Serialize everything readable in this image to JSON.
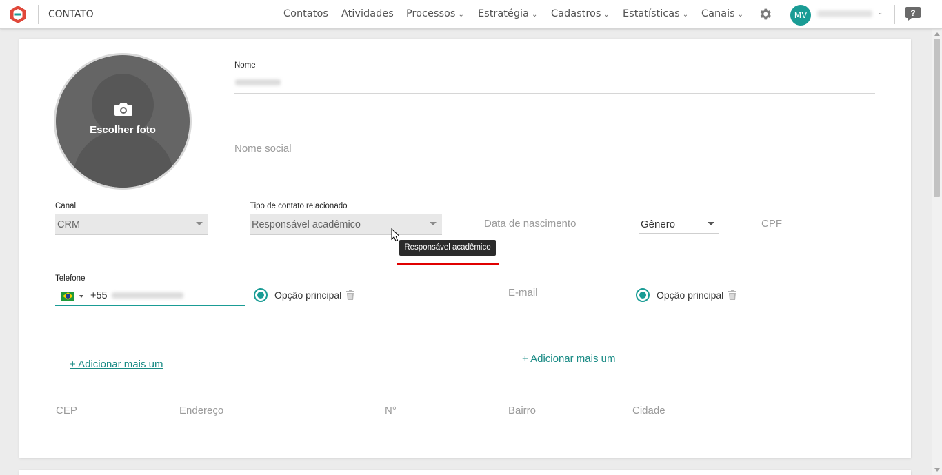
{
  "header": {
    "app_title": "CONTATO",
    "nav": [
      {
        "label": "Contatos",
        "chev": ""
      },
      {
        "label": "Atividades",
        "chev": ""
      },
      {
        "label": "Processos",
        "chev": "⌄"
      },
      {
        "label": "Estratégia",
        "chev": "⌄"
      },
      {
        "label": "Cadastros",
        "chev": "⌄"
      },
      {
        "label": "Estatísticas",
        "chev": "⌄"
      },
      {
        "label": "Canais",
        "chev": "⌄"
      }
    ],
    "avatar_initials": "MV",
    "user_chevron": "⌄",
    "accent_color": "#1a9c95",
    "logo_color": "#e0483a"
  },
  "photo": {
    "label": "Escolher foto"
  },
  "form": {
    "nome_label": "Nome",
    "nome_social_placeholder": "Nome social",
    "canal": {
      "label": "Canal",
      "value": "CRM"
    },
    "tipo_contato": {
      "label": "Tipo de contato relacionado",
      "value": "Responsável acadêmico"
    },
    "tooltip": "Responsável acadêmico",
    "data_nascimento_placeholder": "Data de nascimento",
    "genero_value": "Gênero",
    "cpf_placeholder": "CPF",
    "telefone": {
      "label": "Telefone",
      "dial_code": "+55"
    },
    "opcao_principal_1": "Opção principal",
    "email_placeholder": "E-mail",
    "opcao_principal_2": "Opção principal",
    "add_more_1": "+ Adicionar mais um",
    "add_more_2": "+ Adicionar mais um",
    "cep_placeholder": "CEP",
    "endereco_placeholder": "Endereço",
    "numero_placeholder": "N°",
    "bairro_placeholder": "Bairro",
    "cidade_placeholder": "Cidade"
  }
}
